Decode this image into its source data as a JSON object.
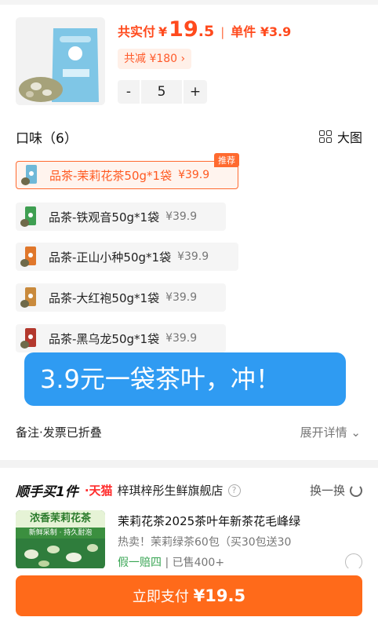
{
  "header": {
    "total_label": "共实付",
    "currency": "¥",
    "total_int": "19",
    "total_dec": ".5",
    "separator": "|",
    "unit_label": "单件 ¥3.9",
    "reduce_tag": "共减 ¥180 ›"
  },
  "stepper": {
    "minus": "-",
    "quantity": "5",
    "plus": "+"
  },
  "flavor": {
    "title": "口味（6）",
    "big_view_label": "大图",
    "options": [
      {
        "name": "品茶-茉莉花茶50g*1袋",
        "price": "¥39.9",
        "badge": "推荐",
        "color": "#6fb8d8"
      },
      {
        "name": "品茶-铁观音50g*1袋",
        "price": "¥39.9",
        "color": "#3f9f52"
      },
      {
        "name": "品茶-正山小种50g*1袋",
        "price": "¥39.9",
        "color": "#e0772b"
      },
      {
        "name": "品茶-大红袍50g*1袋",
        "price": "¥39.9",
        "color": "#c98a3c"
      },
      {
        "name": "品茶-黑乌龙50g*1袋",
        "price": "¥39.9",
        "color": "#b3382d"
      }
    ]
  },
  "overlay": {
    "text": "3.9元一袋茶叶，冲！"
  },
  "remark": {
    "label": "备注·发票已折叠",
    "expand": "展开详情 ⌄"
  },
  "recommend": {
    "brand": "顺手买1件",
    "tmall": "·天猫",
    "shop": "梓琪梓彤生鲜旗舰店",
    "help": "?",
    "swap": "换一换",
    "img_banner": "浓香茉莉花茶",
    "img_sub": "新鲜采制 · 持久耐泡",
    "title": "茉莉花茶2025茶叶年新茶花毛峰绿",
    "desc": "热卖！茉莉绿茶60包（买30包送30",
    "guarantee": "假一赔四",
    "sold": " | 已售400+"
  },
  "pay": {
    "label": "立即支付 ",
    "amount": "¥19.5"
  },
  "colors": {
    "accent": "#ff6a1a",
    "overlay": "#2f9bf2",
    "tmall": "#ff2c2c"
  }
}
